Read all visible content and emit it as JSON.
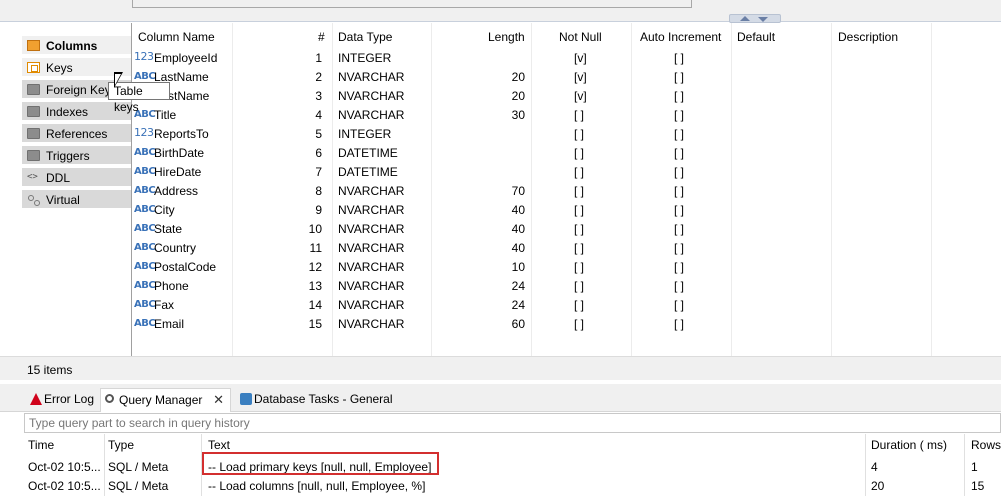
{
  "side_tabs": [
    {
      "label": "Columns",
      "icon": "columns-icon"
    },
    {
      "label": "Keys",
      "icon": "key-icon"
    },
    {
      "label": "Foreign Keys",
      "icon": "foreign-keys-icon"
    },
    {
      "label": "Indexes",
      "icon": "indexes-icon"
    },
    {
      "label": "References",
      "icon": "references-icon"
    },
    {
      "label": "Triggers",
      "icon": "triggers-icon"
    },
    {
      "label": "DDL",
      "icon": "ddl-icon"
    },
    {
      "label": "Virtual",
      "icon": "virtual-icon"
    }
  ],
  "tooltip": "Table keys",
  "grid": {
    "headers": {
      "name": "Column Name",
      "num": "#",
      "type": "Data Type",
      "length": "Length",
      "not_null": "Not Null",
      "auto_inc": "Auto Increment",
      "default": "Default",
      "description": "Description"
    },
    "rows": [
      {
        "icon": "123",
        "name": "EmployeeId",
        "num": "1",
        "type": "INTEGER",
        "length": "",
        "not_null": "[v]",
        "auto_inc": "[ ]"
      },
      {
        "icon": "ABC",
        "name": "LastName",
        "num": "2",
        "type": "NVARCHAR",
        "length": "20",
        "not_null": "[v]",
        "auto_inc": "[ ]"
      },
      {
        "icon": "ABC",
        "name": "FirstName",
        "num": "3",
        "type": "NVARCHAR",
        "length": "20",
        "not_null": "[v]",
        "auto_inc": "[ ]"
      },
      {
        "icon": "ABC",
        "name": "Title",
        "num": "4",
        "type": "NVARCHAR",
        "length": "30",
        "not_null": "[ ]",
        "auto_inc": "[ ]"
      },
      {
        "icon": "123",
        "name": "ReportsTo",
        "num": "5",
        "type": "INTEGER",
        "length": "",
        "not_null": "[ ]",
        "auto_inc": "[ ]"
      },
      {
        "icon": "ABC",
        "name": "BirthDate",
        "num": "6",
        "type": "DATETIME",
        "length": "",
        "not_null": "[ ]",
        "auto_inc": "[ ]"
      },
      {
        "icon": "ABC",
        "name": "HireDate",
        "num": "7",
        "type": "DATETIME",
        "length": "",
        "not_null": "[ ]",
        "auto_inc": "[ ]"
      },
      {
        "icon": "ABC",
        "name": "Address",
        "num": "8",
        "type": "NVARCHAR",
        "length": "70",
        "not_null": "[ ]",
        "auto_inc": "[ ]"
      },
      {
        "icon": "ABC",
        "name": "City",
        "num": "9",
        "type": "NVARCHAR",
        "length": "40",
        "not_null": "[ ]",
        "auto_inc": "[ ]"
      },
      {
        "icon": "ABC",
        "name": "State",
        "num": "10",
        "type": "NVARCHAR",
        "length": "40",
        "not_null": "[ ]",
        "auto_inc": "[ ]"
      },
      {
        "icon": "ABC",
        "name": "Country",
        "num": "11",
        "type": "NVARCHAR",
        "length": "40",
        "not_null": "[ ]",
        "auto_inc": "[ ]"
      },
      {
        "icon": "ABC",
        "name": "PostalCode",
        "num": "12",
        "type": "NVARCHAR",
        "length": "10",
        "not_null": "[ ]",
        "auto_inc": "[ ]"
      },
      {
        "icon": "ABC",
        "name": "Phone",
        "num": "13",
        "type": "NVARCHAR",
        "length": "24",
        "not_null": "[ ]",
        "auto_inc": "[ ]"
      },
      {
        "icon": "ABC",
        "name": "Fax",
        "num": "14",
        "type": "NVARCHAR",
        "length": "24",
        "not_null": "[ ]",
        "auto_inc": "[ ]"
      },
      {
        "icon": "ABC",
        "name": "Email",
        "num": "15",
        "type": "NVARCHAR",
        "length": "60",
        "not_null": "[ ]",
        "auto_inc": "[ ]"
      }
    ]
  },
  "items_count": "15 items",
  "view_tabs": [
    {
      "label": "Error Log",
      "icon": "error-log-icon"
    },
    {
      "label": "Query Manager",
      "icon": "query-manager-icon"
    },
    {
      "label": "Database Tasks - General",
      "icon": "database-tasks-icon"
    }
  ],
  "query_search": {
    "placeholder": "Type query part to search in query history"
  },
  "query_table": {
    "headers": {
      "time": "Time",
      "type": "Type",
      "text": "Text",
      "duration": "Duration ( ms)",
      "rows": "Rows"
    },
    "rows": [
      {
        "time": "Oct-02 10:5...",
        "type": "SQL / Meta",
        "text": "-- Load primary keys [null, null, Employee]",
        "duration": "4",
        "rows": "1"
      },
      {
        "time": "Oct-02 10:5...",
        "type": "SQL / Meta",
        "text": "-- Load columns [null, null, Employee, %]",
        "duration": "20",
        "rows": "15"
      }
    ]
  },
  "colors": {
    "highlight": "#d32f2f",
    "type_icon": "#3a72b8"
  }
}
